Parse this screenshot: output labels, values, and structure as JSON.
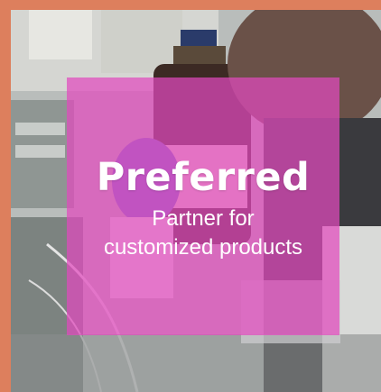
{
  "card": {
    "title": "Preferred",
    "subtitle_line1": "Partner for",
    "subtitle_line2": "customized products"
  },
  "colors": {
    "frame": "#dd7f5d",
    "overlay": "#e24abe",
    "text": "#ffffff"
  },
  "photo": {
    "subject": "laboratory-scene"
  }
}
